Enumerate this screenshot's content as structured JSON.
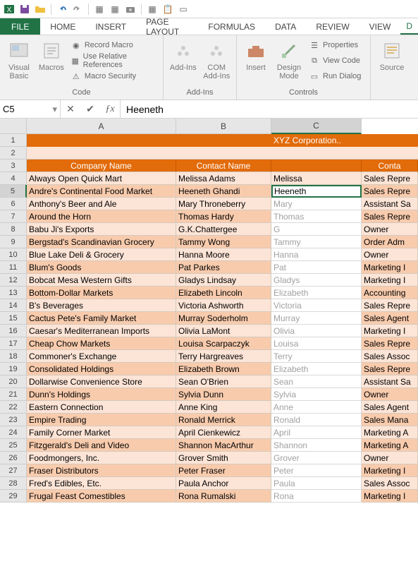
{
  "qat_icons": [
    "excel",
    "save",
    "folder",
    "undo",
    "redo",
    "open",
    "grid",
    "camera",
    "insert",
    "paste",
    "newdoc"
  ],
  "tabs": [
    "FILE",
    "HOME",
    "INSERT",
    "PAGE LAYOUT",
    "FORMULAS",
    "DATA",
    "REVIEW",
    "VIEW",
    "D"
  ],
  "ribbon": {
    "code": {
      "visual_basic": "Visual\nBasic",
      "macros": "Macros",
      "record": "Record Macro",
      "relrefs": "Use Relative References",
      "security": "Macro Security",
      "label": "Code"
    },
    "addins": {
      "addins": "Add-Ins",
      "com": "COM\nAdd-Ins",
      "label": "Add-Ins"
    },
    "controls": {
      "insert": "Insert",
      "design": "Design\nMode",
      "props": "Properties",
      "view_code": "View Code",
      "run_dialog": "Run Dialog",
      "label": "Controls"
    },
    "xml": {
      "source": "Source"
    }
  },
  "namebox": "C5",
  "formula": "Heeneth",
  "columns": [
    "A",
    "B",
    "C"
  ],
  "selected_col": "C",
  "title": "XYZ Corporation..",
  "headers": {
    "A": "Company Name",
    "B": "Contact Name",
    "D": "Conta"
  },
  "selected_row": 5,
  "rows": [
    {
      "n": 4,
      "a": "Always Open Quick Mart",
      "b": "Melissa Adams",
      "c": "Melissa",
      "d": "Sales Repre"
    },
    {
      "n": 5,
      "a": "Andre's Continental Food Market",
      "b": "Heeneth Ghandi",
      "c": "Heeneth",
      "d": "Sales Repre"
    },
    {
      "n": 6,
      "a": "Anthony's Beer and Ale",
      "b": "Mary Throneberry",
      "c": "Mary",
      "d": "Assistant Sa"
    },
    {
      "n": 7,
      "a": "Around the Horn",
      "b": "Thomas Hardy",
      "c": "Thomas",
      "d": "Sales Repre"
    },
    {
      "n": 8,
      "a": "Babu Ji's Exports",
      "b": "G.K.Chattergee",
      "c": "G",
      "d": "Owner"
    },
    {
      "n": 9,
      "a": "Bergstad's Scandinavian Grocery",
      "b": "Tammy Wong",
      "c": "Tammy",
      "d": "Order Adm"
    },
    {
      "n": 10,
      "a": "Blue Lake Deli & Grocery",
      "b": "Hanna Moore",
      "c": "Hanna",
      "d": "Owner"
    },
    {
      "n": 11,
      "a": "Blum's Goods",
      "b": "Pat Parkes",
      "c": "Pat",
      "d": "Marketing I"
    },
    {
      "n": 12,
      "a": "Bobcat Mesa Western Gifts",
      "b": "Gladys Lindsay",
      "c": "Gladys",
      "d": "Marketing I"
    },
    {
      "n": 13,
      "a": "Bottom-Dollar Markets",
      "b": "Elizabeth Lincoln",
      "c": "Elizabeth",
      "d": "Accounting"
    },
    {
      "n": 14,
      "a": "B's Beverages",
      "b": "Victoria Ashworth",
      "c": "Victoria",
      "d": "Sales Repre"
    },
    {
      "n": 15,
      "a": "Cactus Pete's Family Market",
      "b": "Murray Soderholm",
      "c": "Murray",
      "d": "Sales Agent"
    },
    {
      "n": 16,
      "a": "Caesar's Mediterranean Imports",
      "b": "Olivia LaMont",
      "c": "Olivia",
      "d": "Marketing I"
    },
    {
      "n": 17,
      "a": "Cheap Chow Markets",
      "b": "Louisa Scarpaczyk",
      "c": "Louisa",
      "d": "Sales Repre"
    },
    {
      "n": 18,
      "a": "Commoner's Exchange",
      "b": "Terry Hargreaves",
      "c": "Terry",
      "d": "Sales Assoc"
    },
    {
      "n": 19,
      "a": "Consolidated Holdings",
      "b": "Elizabeth Brown",
      "c": "Elizabeth",
      "d": "Sales Repre"
    },
    {
      "n": 20,
      "a": "Dollarwise Convenience Store",
      "b": "Sean O'Brien",
      "c": "Sean",
      "d": "Assistant Sa"
    },
    {
      "n": 21,
      "a": "Dunn's Holdings",
      "b": "Sylvia Dunn",
      "c": "Sylvia",
      "d": "Owner"
    },
    {
      "n": 22,
      "a": "Eastern Connection",
      "b": "Anne King",
      "c": "Anne",
      "d": "Sales Agent"
    },
    {
      "n": 23,
      "a": "Empire Trading",
      "b": "Ronald Merrick",
      "c": "Ronald",
      "d": "Sales Mana"
    },
    {
      "n": 24,
      "a": "Family Corner Market",
      "b": "April Cienkewicz",
      "c": "April",
      "d": "Marketing A"
    },
    {
      "n": 25,
      "a": "Fitzgerald's Deli and Video",
      "b": "Shannon MacArthur",
      "c": "Shannon",
      "d": "Marketing A"
    },
    {
      "n": 26,
      "a": "Foodmongers, Inc.",
      "b": "Grover Smith",
      "c": "Grover",
      "d": "Owner"
    },
    {
      "n": 27,
      "a": "Fraser Distributors",
      "b": "Peter Fraser",
      "c": "Peter",
      "d": "Marketing I"
    },
    {
      "n": 28,
      "a": "Fred's Edibles, Etc.",
      "b": "Paula Anchor",
      "c": "Paula",
      "d": "Sales Assoc"
    },
    {
      "n": 29,
      "a": "Frugal Feast Comestibles",
      "b": "Rona Rumalski",
      "c": "Rona",
      "d": "Marketing I"
    }
  ]
}
